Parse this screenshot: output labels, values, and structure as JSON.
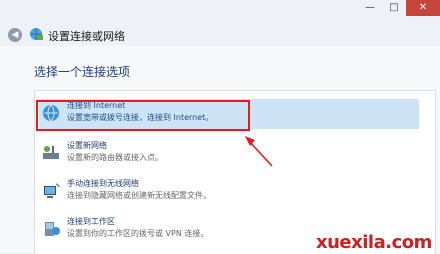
{
  "window": {
    "title": "设置连接或网络",
    "controls": {
      "minimize": "—",
      "maximize": "□",
      "close": "✕"
    }
  },
  "heading": "选择一个连接选项",
  "options": [
    {
      "icon": "globe-network-icon",
      "title": "连接到 Internet",
      "desc": "设置宽带或拨号连接，连接到 Internet。",
      "selected": true
    },
    {
      "icon": "router-icon",
      "title": "设置新网络",
      "desc": "设置新的路由器或接入点。",
      "selected": false
    },
    {
      "icon": "wireless-computer-icon",
      "title": "手动连接到无线网络",
      "desc": "连接到隐藏网络或创建新无线配置文件。",
      "selected": false
    },
    {
      "icon": "workplace-icon",
      "title": "连接到工作区",
      "desc": "设置到你的工作区的拨号或 VPN 连接。",
      "selected": false
    }
  ],
  "annotation": {
    "color": "#e21d1d"
  },
  "watermark": "xuexila.com"
}
